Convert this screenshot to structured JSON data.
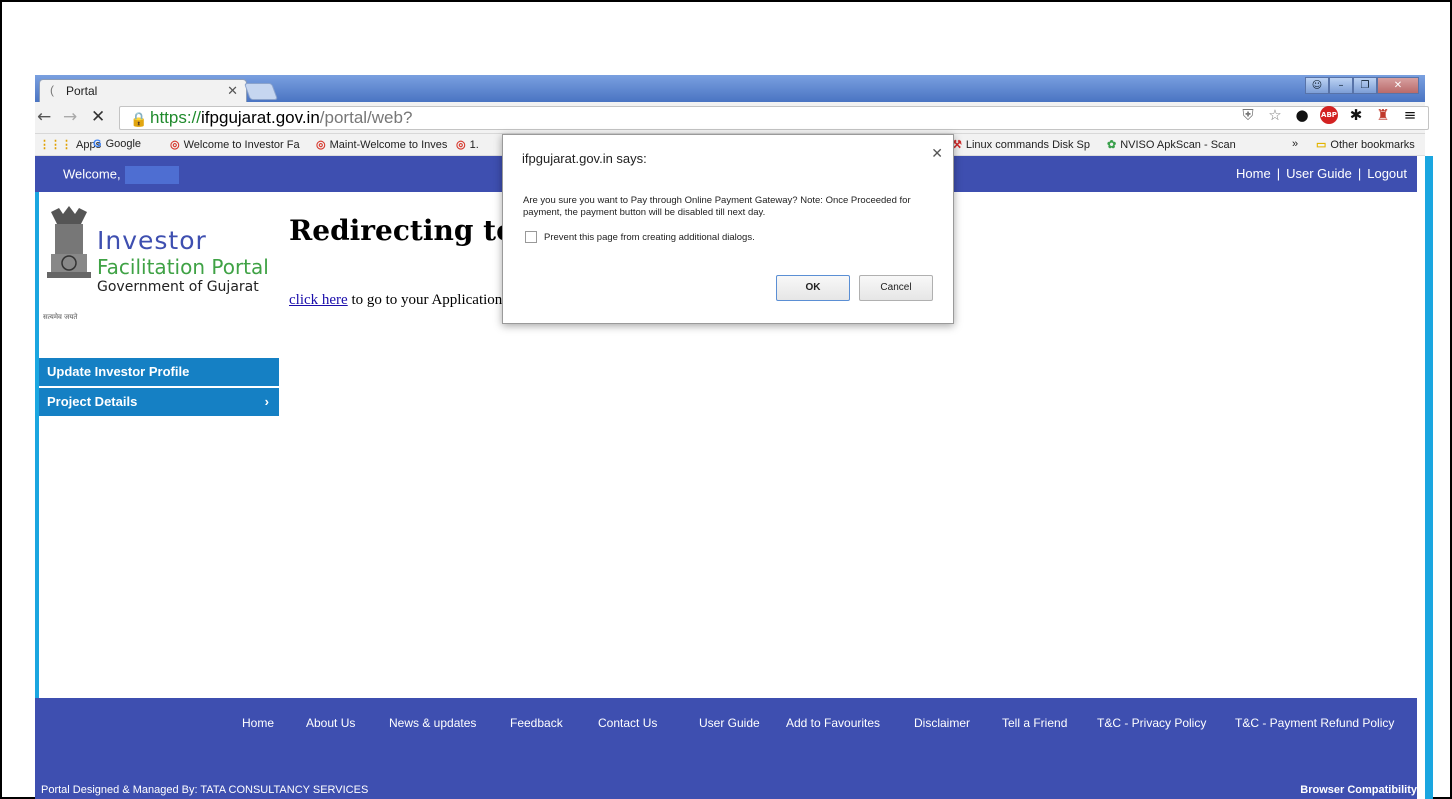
{
  "browser": {
    "tab_title": "Portal",
    "url": {
      "scheme": "https://",
      "host": "ifpgujarat.gov.in",
      "path": "/portal/web?"
    },
    "bookmarks": [
      {
        "icon": "apps",
        "label": "Apps"
      },
      {
        "icon": "google",
        "label": "Google"
      },
      {
        "icon": "opera",
        "label": "Welcome to Investor Fa"
      },
      {
        "icon": "opera",
        "label": "Maint-Welcome to Inves"
      },
      {
        "icon": "opera",
        "label": "1."
      },
      {
        "icon": "tool",
        "label": "Linux commands Disk Sp"
      },
      {
        "icon": "android",
        "label": "NVISO ApkScan - Scan"
      }
    ],
    "more_bookmarks": "»",
    "other_bookmarks": "Other bookmarks"
  },
  "site": {
    "welcome": "Welcome,",
    "top_links": [
      "Home",
      "User Guide",
      "Logout"
    ],
    "logo": {
      "line1": "Investor",
      "line2": "Facilitation Portal",
      "line3": "Government of Gujarat",
      "motto": "सत्यमेव जयते"
    },
    "nav": [
      {
        "label": "Update Investor Profile",
        "chevron": ""
      },
      {
        "label": "Project Details",
        "chevron": "›"
      }
    ],
    "heading": "Redirecting to P",
    "redirect_link": "click here",
    "redirect_rest": " to go to your Application"
  },
  "footer": {
    "links": [
      "Home",
      "About Us",
      "News & updates",
      "Feedback",
      "Contact Us",
      "User Guide",
      "Add to Favourites",
      "Disclaimer",
      "Tell a Friend",
      "T&C - Privacy Policy",
      "T&C - Payment Refund Policy"
    ],
    "designed_by": "Portal Designed & Managed By: TATA CONSULTANCY SERVICES",
    "browser_compat": "Browser Compatibility"
  },
  "dialog": {
    "title": "ifpgujarat.gov.in says:",
    "message": "Are you sure you want to Pay through Online Payment Gateway? Note: Once Proceeded for payment, the payment button will be disabled till next day.",
    "checkbox_label": "Prevent this page from creating additional dialogs.",
    "ok": "OK",
    "cancel": "Cancel"
  },
  "colors": {
    "header_blue": "#3e4fb0",
    "nav_blue": "#1580c4",
    "side_accent": "#1aa6e0"
  }
}
